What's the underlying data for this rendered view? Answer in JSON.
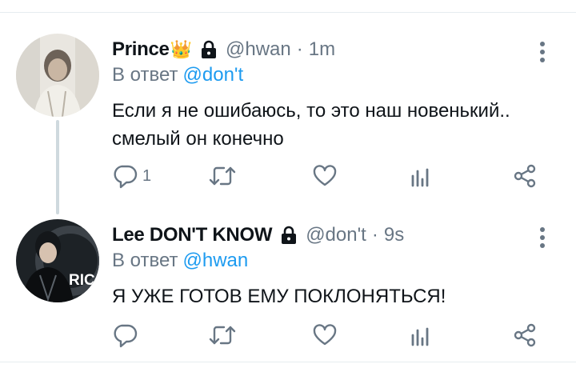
{
  "tweets": [
    {
      "name": "Prince",
      "crown_emoji": "👑",
      "handle": "@hwan",
      "time": "1m",
      "separator": "·",
      "reply_prefix": "В ответ",
      "reply_mention": "@don't",
      "body_line1": "Если я не ошибаюсь, то это наш новенький..",
      "body_line2": "смелый он конечно",
      "reply_count": "1",
      "retweet_count": "",
      "like_count": "",
      "views_count": ""
    },
    {
      "name": "Lee DON'T KNOW",
      "handle": "@don't",
      "time": "9s",
      "separator": "·",
      "reply_prefix": "В ответ",
      "reply_mention": "@hwan",
      "body_line1": "Я УЖЕ ГОТОВ ЕМУ ПОКЛОНЯТЬСЯ!",
      "reply_count": "",
      "retweet_count": "",
      "like_count": "",
      "views_count": ""
    }
  ],
  "avatar_text": "RICA",
  "colors": {
    "text": "#0f1419",
    "secondary": "#687684",
    "link": "#1d9bf0",
    "divider": "#e6ecf0",
    "thread_line": "#cfd9de",
    "crown": "#f2b705"
  },
  "icons": [
    "lock-icon",
    "more-vertical-icon",
    "reply-icon",
    "retweet-icon",
    "like-icon",
    "views-icon",
    "share-icon"
  ]
}
